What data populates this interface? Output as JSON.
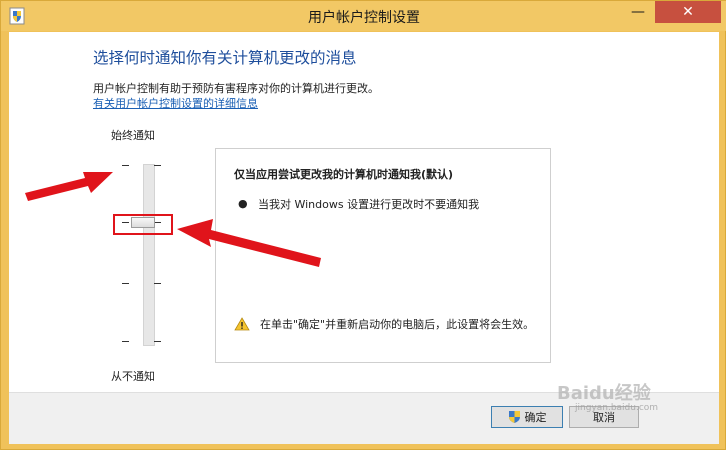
{
  "window": {
    "title": "用户帐户控制设置",
    "minimize_glyph": "—",
    "close_glyph": "✕"
  },
  "main": {
    "heading": "选择何时通知你有关计算机更改的消息",
    "description": "用户帐户控制有助于预防有害程序对你的计算机进行更改。",
    "link": "有关用户帐户控制设置的详细信息"
  },
  "slider": {
    "top_label": "始终通知",
    "bottom_label": "从不通知",
    "levels": 4,
    "selected_level": 3
  },
  "panel": {
    "title": "仅当应用尝试更改我的计算机时通知我(默认)",
    "bullet": "●",
    "bullet_text": "当我对 Windows 设置进行更改时不要通知我",
    "warning": "在单击\"确定\"并重新启动你的电脑后，此设置将会生效。"
  },
  "buttons": {
    "ok": "确定",
    "cancel": "取消"
  },
  "watermark": {
    "text": "Baidu经验",
    "sub": "jingyan.baidu.com"
  },
  "colors": {
    "title_bar": "#f2c865",
    "close_button": "#c7503f",
    "heading": "#1e4e9c",
    "link": "#1a5fb4",
    "annotation": "#e0141b"
  }
}
